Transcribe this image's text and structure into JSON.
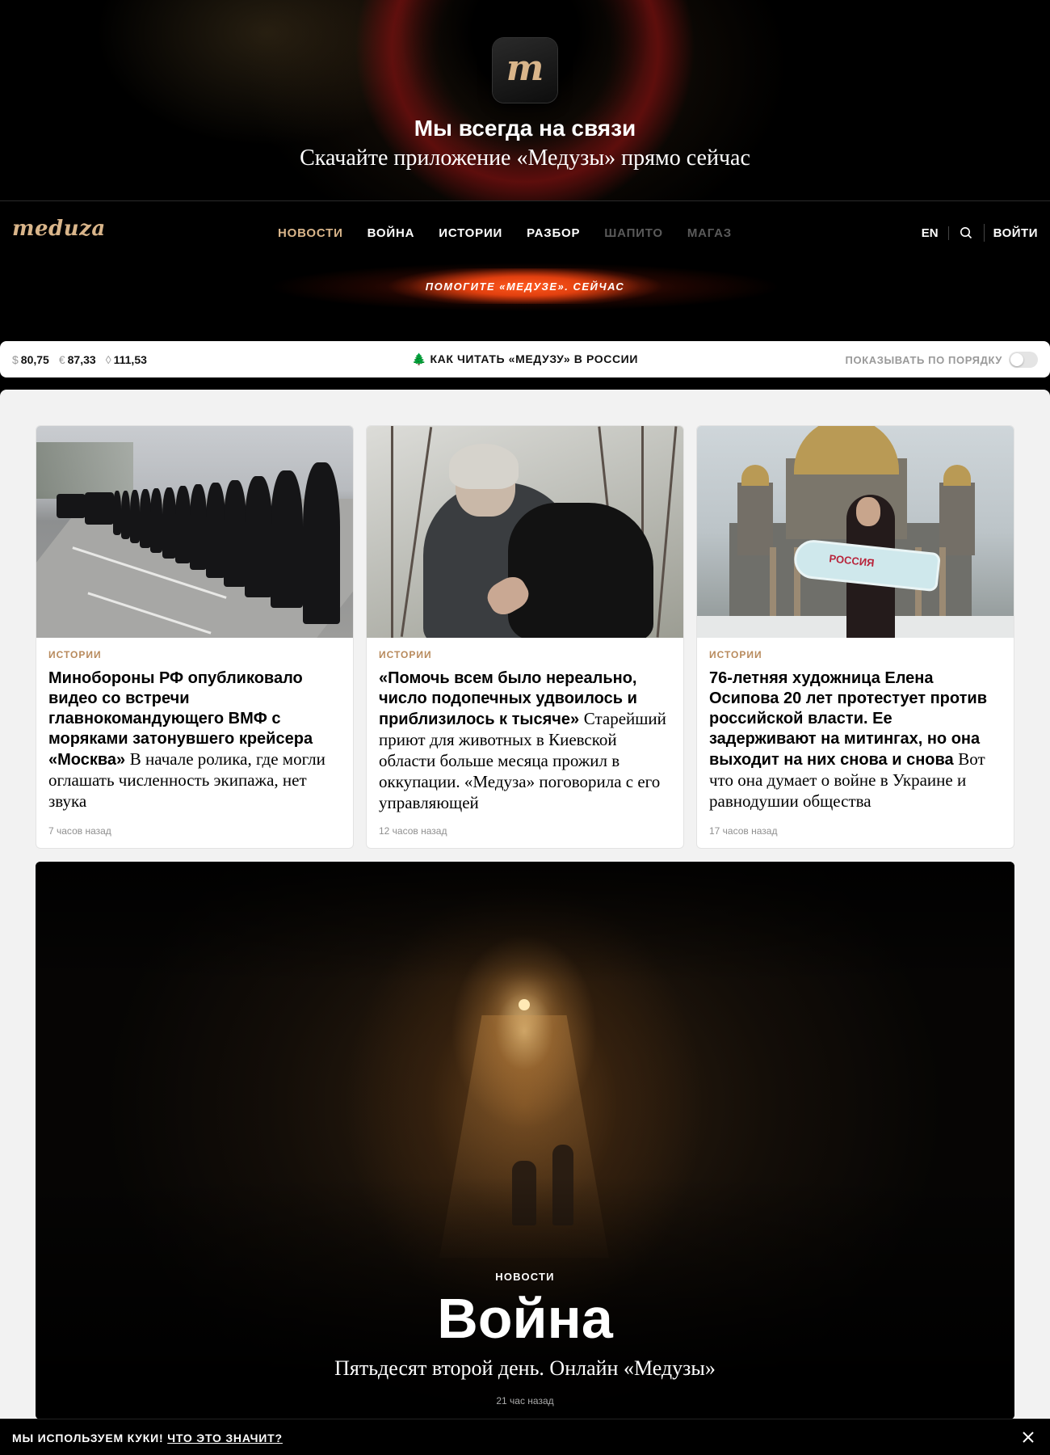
{
  "promo": {
    "app_icon_letter": "m",
    "title": "Мы всегда на связи",
    "subtitle": "Скачайте приложение «Медузы» прямо сейчас"
  },
  "header": {
    "logo": "meduza",
    "nav": [
      {
        "label": "НОВОСТИ",
        "state": "active"
      },
      {
        "label": "ВОЙНА",
        "state": "normal"
      },
      {
        "label": "ИСТОРИИ",
        "state": "normal"
      },
      {
        "label": "РАЗБОР",
        "state": "normal"
      },
      {
        "label": "ШАПИТО",
        "state": "dim"
      },
      {
        "label": "МАГАЗ",
        "state": "dim"
      }
    ],
    "lang": "EN",
    "search_icon": "search-icon",
    "login": "ВОЙТИ",
    "donate": "ПОМОГИТЕ «МЕДУЗЕ». СЕЙЧАС"
  },
  "infobar": {
    "rates": [
      {
        "symbol": "$",
        "value": "80,75"
      },
      {
        "symbol": "€",
        "value": "87,33"
      },
      {
        "symbol": "◊",
        "value": "111,53"
      }
    ],
    "howto": "🌲 КАК ЧИТАТЬ «МЕДУЗУ» В РОССИИ",
    "order_label": "ПОКАЗЫВАТЬ ПО ПОРЯДКУ",
    "order_toggle_on": false
  },
  "cards": [
    {
      "tag": "ИСТОРИИ",
      "headline": "Минобороны РФ опубликовало видео со встречи главнокомандующего ВМФ с моряками затонувшего крейсера «Москва»",
      "lead": "В начале ролика, где могли оглашать численность экипажа, нет звука",
      "time": "7 часов назад"
    },
    {
      "tag": "ИСТОРИИ",
      "headline": "«Помочь всем было нереально, число подопечных удвоилось и приблизилось к тысяче»",
      "lead": "Старейший приют для животных в Киевской области больше месяца прожил в оккупации. «Медуза» поговорила с его управляющей",
      "time": "12 часов назад"
    },
    {
      "tag": "ИСТОРИИ",
      "headline": "76-летняя художница Елена Осипова 20 лет протестует против российской власти. Ее задерживают на митингах, но она выходит на них снова и снова",
      "lead": "Вот что она думает о войне в Украине и равнодушии общества",
      "time": "17 часов назад",
      "photo_sign": "РОССИЯ"
    }
  ],
  "feature": {
    "tag": "НОВОСТИ",
    "title": "Война",
    "subtitle": "Пятьдесят второй день. Онлайн «Медузы»",
    "time": "21 час назад"
  },
  "cookie": {
    "text": "МЫ ИСПОЛЬЗУЕМ КУКИ!",
    "link": "ЧТО ЭТО ЗНАЧИТ?",
    "close_icon": "close-icon"
  },
  "colors": {
    "accent": "#d9b58a",
    "donate": "#e2400f",
    "tag": "#b88a5c",
    "page_bg": "#f2f2f2"
  }
}
